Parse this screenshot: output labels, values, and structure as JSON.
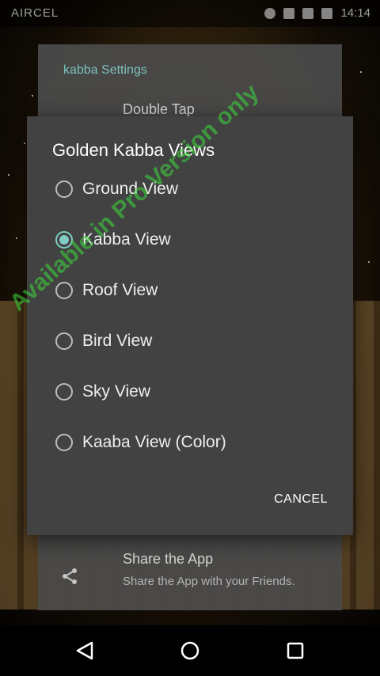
{
  "status_bar": {
    "carrier": "AIRCEL",
    "time": "14:14"
  },
  "settings": {
    "title": "kabba Settings",
    "double_tap_title": "Double Tap",
    "share_title": "Share the App",
    "share_subtitle": "Share the App with your Friends."
  },
  "watermark": "Available in Pro Version only",
  "dialog": {
    "title": "Golden Kabba Views",
    "options": [
      {
        "label": "Ground View",
        "checked": false
      },
      {
        "label": "Kabba View",
        "checked": true
      },
      {
        "label": "Roof View",
        "checked": false
      },
      {
        "label": "Bird View",
        "checked": false
      },
      {
        "label": "Sky View",
        "checked": false
      },
      {
        "label": "Kaaba View (Color)",
        "checked": false
      }
    ],
    "cancel_label": "CANCEL"
  },
  "navigation": {
    "icons": [
      "back-icon",
      "home-icon",
      "recents-icon"
    ]
  },
  "colors": {
    "accent": "#80cbc4",
    "dialog_bg": "#424242",
    "watermark": "#3cdc3c"
  }
}
